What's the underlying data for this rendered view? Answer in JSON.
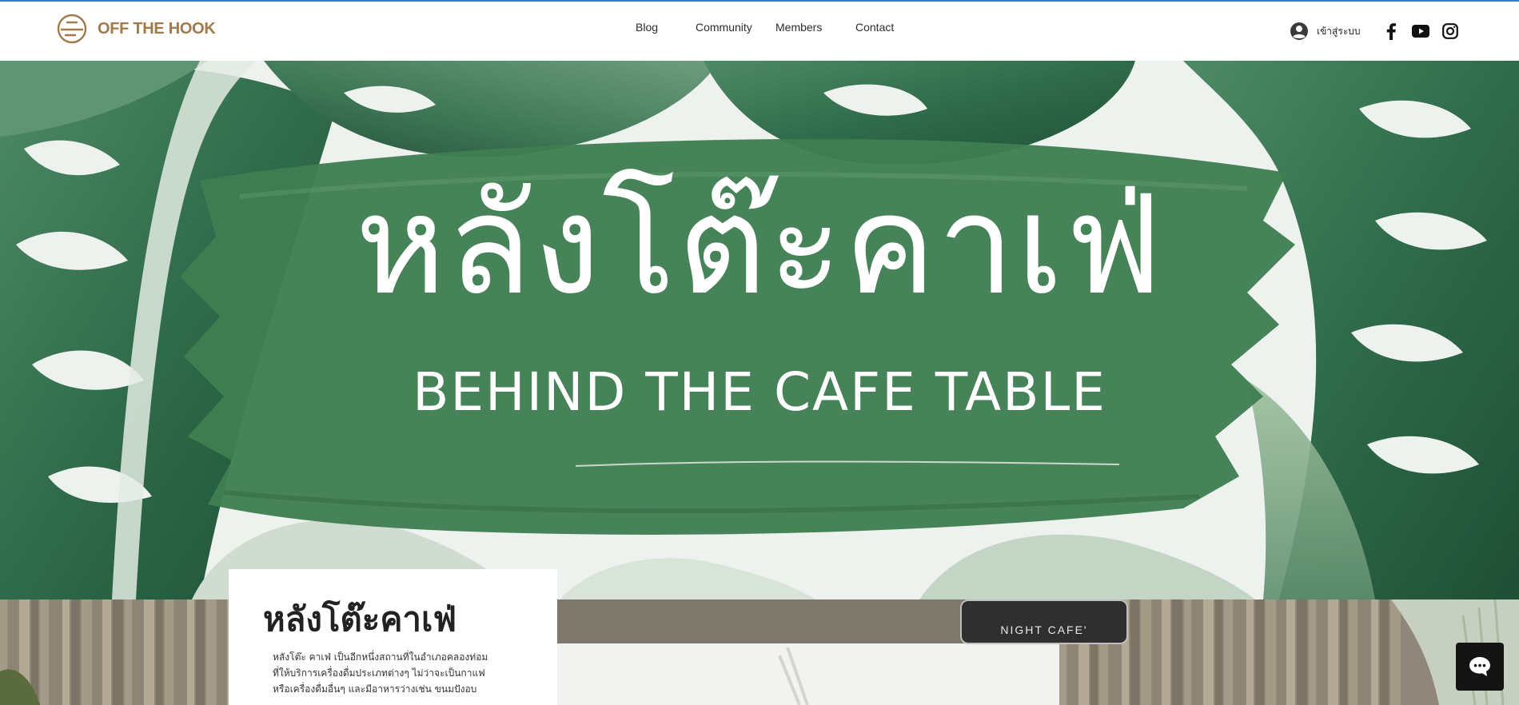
{
  "header": {
    "brand": "OFF THE HOOK",
    "nav": [
      {
        "label": "Blog"
      },
      {
        "label": "Community"
      },
      {
        "label": "Members"
      },
      {
        "label": "Contact"
      }
    ],
    "login_label": "เข้าสู่ระบบ",
    "social": [
      "facebook-icon",
      "youtube-icon",
      "instagram-icon"
    ],
    "brand_color": "#a07a48"
  },
  "hero": {
    "title": "หลังโต๊ะคาเฟ่",
    "subtitle": "BEHIND THE CAFE TABLE",
    "brush_color": "#3f7e51"
  },
  "sign": {
    "text": "NIGHT CAFE'"
  },
  "about": {
    "title": "หลังโต๊ะคาเฟ่",
    "lines": [
      "หลังโต๊ะ คาเฟ่ เป็นอีกหนึ่งสถานที่ในอำเภอคลองท่อม",
      "ที่ให้บริการเครื่องดื่มประเภทต่างๆ ไม่ว่าจะเป็นกาแฟ",
      "หรือเครื่องดื่มอื่นๆ และมีอาหารว่างเช่น ขนมปังอบ"
    ]
  },
  "chat": {
    "icon": "chat-icon"
  }
}
